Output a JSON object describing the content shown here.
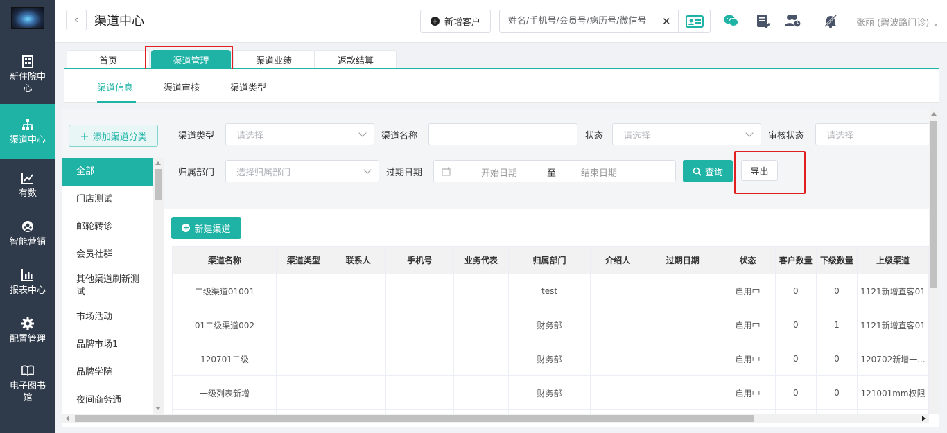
{
  "nav": {
    "items": [
      {
        "label": "新住院中心",
        "icon": "building-icon"
      },
      {
        "label": "渠道中心",
        "icon": "org-chart-icon"
      },
      {
        "label": "有数",
        "icon": "trend-chart-icon"
      },
      {
        "label": "智能营销",
        "icon": "marketing-icon"
      },
      {
        "label": "报表中心",
        "icon": "bar-chart-icon"
      },
      {
        "label": "配置管理",
        "icon": "gear-icon"
      },
      {
        "label": "电子图书馆",
        "icon": "book-icon"
      }
    ]
  },
  "header": {
    "title": "渠道中心",
    "new_customer_label": "新增客户",
    "search_placeholder": "姓名/手机号/会员号/病历号/微信号",
    "user_name": "张丽 (碧波路门诊)"
  },
  "tabs": [
    {
      "label": "首页"
    },
    {
      "label": "渠道管理"
    },
    {
      "label": "渠道业绩"
    },
    {
      "label": "返款结算"
    }
  ],
  "subtabs": [
    {
      "label": "渠道信息"
    },
    {
      "label": "渠道审核"
    },
    {
      "label": "渠道类型"
    }
  ],
  "categories": {
    "add_label": "添加渠道分类",
    "items": [
      "全部",
      "门店测试",
      "邮轮转诊",
      "会员社群",
      "其他渠道刷新测试",
      "市场活动",
      "品牌市场1",
      "品牌学院",
      "夜间商务通"
    ]
  },
  "filters": {
    "channel_type_label": "渠道类型",
    "channel_type_placeholder": "请选择",
    "channel_name_label": "渠道名称",
    "status_label": "状态",
    "status_placeholder": "请选择",
    "review_status_label": "审核状态",
    "review_status_placeholder": "请选择",
    "dept_label": "归属部门",
    "dept_placeholder": "选择归属部门",
    "expiry_label": "过期日期",
    "start_placeholder": "开始日期",
    "range_sep": "至",
    "end_placeholder": "结束日期",
    "query_label": "查询",
    "export_label": "导出"
  },
  "new_channel_label": "新建渠道",
  "table": {
    "columns": [
      "渠道名称",
      "渠道类型",
      "联系人",
      "手机号",
      "业务代表",
      "归属部门",
      "介绍人",
      "过期日期",
      "状态",
      "客户数量",
      "下级数量",
      "上级渠道"
    ],
    "rows": [
      [
        "二级渠道01001",
        "",
        "",
        "",
        "",
        "test",
        "",
        "",
        "启用中",
        "0",
        "0",
        "1121新增直客01"
      ],
      [
        "01二级渠道002",
        "",
        "",
        "",
        "",
        "财务部",
        "",
        "",
        "启用中",
        "0",
        "1",
        "1121新增直客01"
      ],
      [
        "120701二级",
        "",
        "",
        "",
        "",
        "财务部",
        "",
        "",
        "启用中",
        "0",
        "0",
        "120702新增一..."
      ],
      [
        "一级列表新增",
        "",
        "",
        "",
        "",
        "财务部",
        "",
        "",
        "启用中",
        "0",
        "0",
        "121001mm权限"
      ],
      [
        "",
        "",
        "",
        "",
        "",
        "",
        "",
        "",
        "",
        "",
        "",
        ""
      ]
    ]
  },
  "colors": {
    "accent": "#1fb3a6",
    "nav_bg": "#2f3a4b",
    "highlight": "#e02020"
  }
}
